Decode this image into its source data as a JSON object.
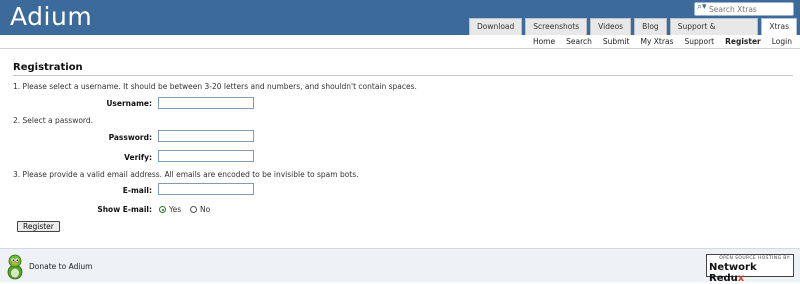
{
  "header": {
    "logo": "Adium",
    "search_placeholder": "Search Xtras",
    "tabs": [
      {
        "label": "Download"
      },
      {
        "label": "Screenshots"
      },
      {
        "label": "Videos"
      },
      {
        "label": "Blog"
      },
      {
        "label": "Support & Development"
      },
      {
        "label": "Xtras",
        "active": true
      }
    ]
  },
  "subnav": {
    "items": [
      {
        "label": "Home"
      },
      {
        "label": "Search"
      },
      {
        "label": "Submit"
      },
      {
        "label": "My Xtras"
      },
      {
        "label": "Support"
      },
      {
        "label": "Register",
        "current": true
      },
      {
        "label": "Login"
      }
    ]
  },
  "form": {
    "title": "Registration",
    "step1": "1. Please select a username. It should be between 3-20 letters and numbers, and shouldn't contain spaces.",
    "username_label": "Username:",
    "step2": "2. Select a password.",
    "password_label": "Password:",
    "verify_label": "Verify:",
    "step3": "3. Please provide a valid email address. All emails are encoded to be invisible to spam bots.",
    "email_label": "E-mail:",
    "show_email_label": "Show E-mail:",
    "yes_label": "Yes",
    "no_label": "No",
    "selected": "Yes",
    "submit_label": "Register"
  },
  "footer": {
    "donate": "Donate to Adium",
    "badge_small": "OPEN SOURCE HOSTING BY:",
    "badge_brand": "Network Redu",
    "badge_brand_accent": "x"
  },
  "colors": {
    "header_bg": "#3c6a9b",
    "footer_bg": "#eef1f5",
    "accent_radio": "#2a7a2a"
  }
}
